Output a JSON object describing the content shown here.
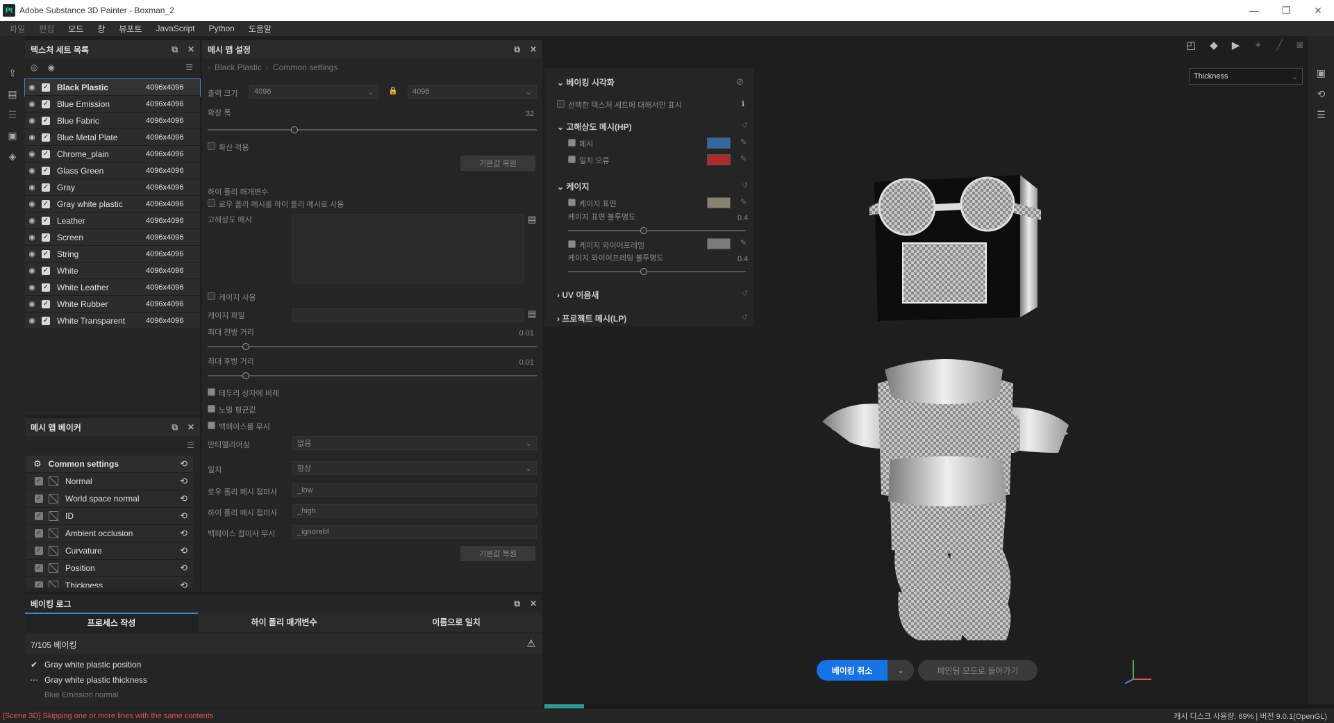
{
  "window": {
    "title": "Adobe Substance 3D Painter - Boxman_2",
    "logo": "Pt",
    "minimize": "—",
    "restore": "❐",
    "close": "✕"
  },
  "menu": [
    {
      "label": "파일",
      "dim": true
    },
    {
      "label": "편집",
      "dim": true
    },
    {
      "label": "모드"
    },
    {
      "label": "창"
    },
    {
      "label": "뷰포트"
    },
    {
      "label": "JavaScript"
    },
    {
      "label": "Python"
    },
    {
      "label": "도움말"
    }
  ],
  "texture_sets": {
    "title": "텍스처 세트 목록",
    "items": [
      {
        "name": "Black Plastic",
        "res": "4096x4096",
        "selected": true
      },
      {
        "name": "Blue Emission",
        "res": "4096x4096"
      },
      {
        "name": "Blue Fabric",
        "res": "4096x4096"
      },
      {
        "name": "Blue Metal Plate",
        "res": "4096x4096"
      },
      {
        "name": "Chrome_plain",
        "res": "4096x4096"
      },
      {
        "name": "Glass Green",
        "res": "4096x4096"
      },
      {
        "name": "Gray",
        "res": "4096x4096"
      },
      {
        "name": "Gray white plastic",
        "res": "4096x4096"
      },
      {
        "name": "Leather",
        "res": "4096x4096"
      },
      {
        "name": "Screen",
        "res": "4096x4096"
      },
      {
        "name": "String",
        "res": "4096x4096"
      },
      {
        "name": "White",
        "res": "4096x4096"
      },
      {
        "name": "White Leather",
        "res": "4096x4096"
      },
      {
        "name": "White Rubber",
        "res": "4096x4096"
      },
      {
        "name": "White Transparent",
        "res": "4096x4096"
      }
    ]
  },
  "baker": {
    "title": "메시 맵 베이커",
    "items": [
      {
        "name": "Common settings",
        "selected": true
      },
      {
        "name": "Normal"
      },
      {
        "name": "World space normal"
      },
      {
        "name": "ID"
      },
      {
        "name": "Ambient occlusion"
      },
      {
        "name": "Curvature"
      },
      {
        "name": "Position"
      },
      {
        "name": "Thickness"
      }
    ]
  },
  "settings": {
    "title": "메시 맵 설정",
    "crumb1": "Black Plastic",
    "crumb2": "Common settings",
    "output_size_label": "출력 크기",
    "output_w": "4096",
    "output_h": "4096",
    "dilation_label": "확장 폭",
    "dilation_val": "32",
    "apply_diffusion": "확산 적용",
    "reset": "기본값 복원",
    "hp_params": "하이 폴리 매개변수",
    "use_lp_as_hp": "로우 폴리 메시를 하이 폴리 메시로 사용",
    "hp_mesh": "고해상도 메시",
    "use_cage": "케이지 사용",
    "cage_file": "케이지 파일",
    "max_front": "최대 전방 거리",
    "max_front_val": "0.01",
    "max_rear": "최대 후방 거리",
    "max_rear_val": "0.01",
    "relative_bbox": "테두리 상자에 비례",
    "avg_normals": "노멀 평균값",
    "ignore_backface": "백페이스를 무시",
    "antialias_label": "안티앨리어싱",
    "antialias_val": "없음",
    "match_label": "일치",
    "match_val": "항상",
    "lp_suffix_label": "로우 폴리 메시 접미사",
    "lp_suffix": "_low",
    "hp_suffix_label": "하이 폴리 메시 접미사",
    "hp_suffix": "_high",
    "bf_suffix_label": "백페이스 접미사 무시",
    "bf_suffix": "_ignorebf",
    "reset2": "기본값 복원"
  },
  "viz": {
    "bake_viz": "베이킹 시각화",
    "only_selected": "선택한 텍스처 세트에 대해서만 표시",
    "hp_section": "고해상도 메시(HP)",
    "mesh": "메시",
    "mesh_color": "#2f6aa0",
    "mismatch": "일치 오류",
    "mismatch_color": "#b02a2a",
    "cage_section": "케이지",
    "cage_surface": "케이지 표면",
    "cage_surface_color": "#8a8070",
    "cage_surface_opacity": "케이지 표면 불투명도",
    "cage_surface_val": "0.4",
    "cage_wire": "케이지 와이어프레임",
    "cage_wire_color": "#7a7a7a",
    "cage_wire_opacity": "케이지 와이어프레임 불투명도",
    "cage_wire_val": "0.4",
    "uv_seams": "UV 이음새",
    "projected": "프로젝트 메시(LP)"
  },
  "viewport": {
    "channel": "Thickness",
    "cancel_bake": "베이킹 취소",
    "back_paint": "페인팅 모드로 돌아가기",
    "progress": 0.05
  },
  "log": {
    "title": "베이킹 로그",
    "tabs": [
      "프로세스 작성",
      "하이 폴리 매개변수",
      "이름으로 일치"
    ],
    "count": "7/105 베이킹",
    "entries": [
      {
        "icon": "✔",
        "text": "Gray white plastic position"
      },
      {
        "icon": "⋯",
        "text": "Gray white plastic thickness"
      },
      {
        "icon": "",
        "text": "Blue Emission normal"
      }
    ]
  },
  "status": {
    "left": "[Scene 3D] Skipping one or more lines with the same contents",
    "right": "캐시 디스크 사용량: 69% | 버전 9.0.1(OpenGL)"
  }
}
